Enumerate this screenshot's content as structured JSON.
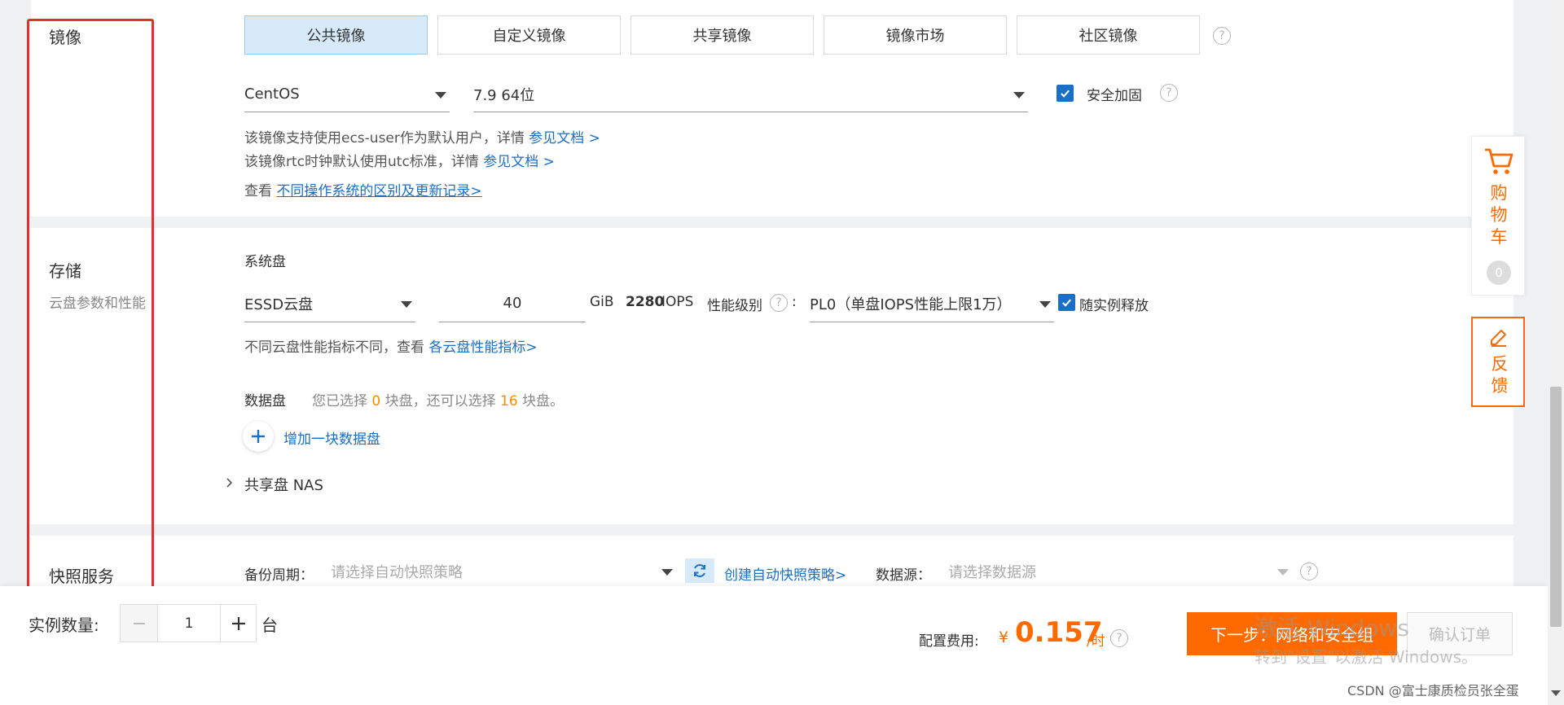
{
  "image_section": {
    "title": "镜像",
    "tabs": [
      "公共镜像",
      "自定义镜像",
      "共享镜像",
      "镜像市场",
      "社区镜像"
    ],
    "os_select": "CentOS",
    "version_select": "7.9 64位",
    "security_label": "安全加固",
    "note1_text": "该镜像支持使用ecs-user作为默认用户，详情 ",
    "note1_link": "参见文档 >",
    "note2_text": "该镜像rtc时钟默认使用utc标准，详情 ",
    "note2_link": "参见文档 >",
    "note3_text": "查看 ",
    "note3_link": "不同操作系统的区别及更新记录>"
  },
  "storage_section": {
    "title": "存储",
    "subtitle": "云盘参数和性能",
    "system_disk_label": "系统盘",
    "disk_type": "ESSD云盘",
    "disk_size": "40",
    "unit": "GiB",
    "iops_value": "2280",
    "iops_label": "IOPS",
    "perf_level_label": "性能级别",
    "perf_colon": ":",
    "perf_level_value": "PL0（单盘IOPS性能上限1万）",
    "release_label": "随实例释放",
    "perf_note_text": "不同云盘性能指标不同，查看 ",
    "perf_note_link": "各云盘性能指标>",
    "data_disk_label": "数据盘",
    "data_disk_pre": "您已选择 ",
    "data_disk_selected": "0",
    "data_disk_mid": " 块盘，还可以选择 ",
    "data_disk_remaining": "16",
    "data_disk_post": " 块盘。",
    "add_disk_label": "增加一块数据盘",
    "nas_label": "共享盘 NAS"
  },
  "snapshot_section": {
    "title": "快照服务",
    "backup_label": "备份周期：",
    "backup_placeholder": "请选择自动快照策略",
    "create_link": "创建自动快照策略>",
    "source_label": "数据源：",
    "source_placeholder": "请选择数据源"
  },
  "sidebar": {
    "cart_label": "购物车",
    "cart_count": "0",
    "feedback_label": "反馈"
  },
  "bottom_bar": {
    "instance_label": "实例数量:",
    "quantity": "1",
    "unit": "台",
    "cost_label": "配置费用:",
    "currency": "¥",
    "price": "0.157",
    "per_hour": "/时",
    "next_button": "下一步：网络和安全组",
    "confirm_button": "确认订单",
    "watermark_line1": "激活 Windows",
    "watermark_line2": "转到\"设置\"以激活 Windows。",
    "credit": "CSDN @富士康质检员张全蛋"
  },
  "colors": {
    "accent_blue": "#1a6fc7",
    "accent_orange": "#ff6a00",
    "highlight_red": "#e62e2e",
    "tab_active_bg": "#d6eafa"
  }
}
